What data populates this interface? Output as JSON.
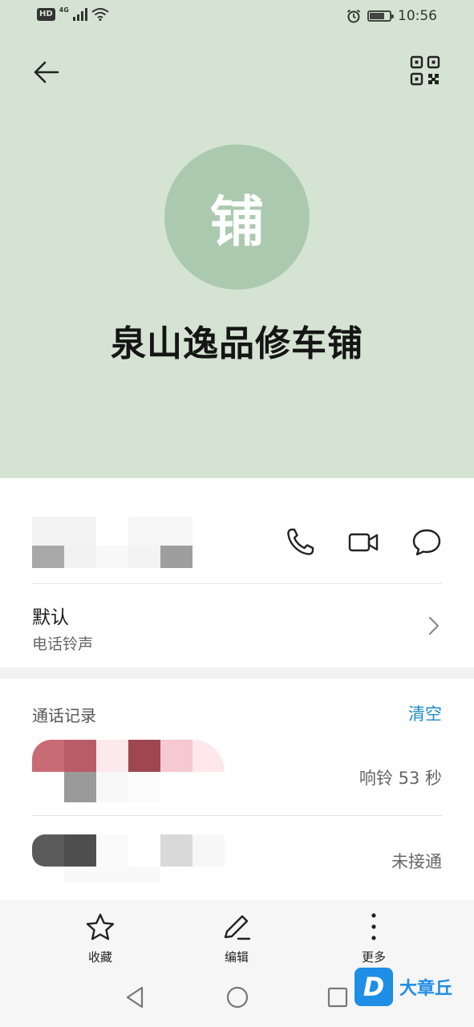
{
  "status_bar": {
    "hd": "HD",
    "network": "4G",
    "battery_level": 0.75,
    "time": "10:56"
  },
  "header": {
    "back_icon": "arrow-left-icon",
    "qr_icon": "qr-code-icon",
    "avatar_char": "铺",
    "contact_name": "泉山逸品修车铺",
    "colors": {
      "background": "#d5e4d2",
      "avatar": "#abc9ae"
    }
  },
  "phone_row": {
    "icons": [
      "phone-icon",
      "video-call-icon",
      "message-icon"
    ]
  },
  "ringtone": {
    "value": "默认",
    "label": "电话铃声"
  },
  "call_log": {
    "title": "通话记录",
    "clear_label": "清空",
    "items": [
      {
        "status": "响铃 53 秒"
      },
      {
        "status": "未接通"
      }
    ]
  },
  "bottom_actions": [
    {
      "icon": "star-icon",
      "label": "收藏"
    },
    {
      "icon": "pencil-icon",
      "label": "编辑"
    },
    {
      "icon": "more-vertical-icon",
      "label": "更多"
    }
  ],
  "watermark": {
    "logo_letter": "D",
    "text": "大章丘"
  }
}
